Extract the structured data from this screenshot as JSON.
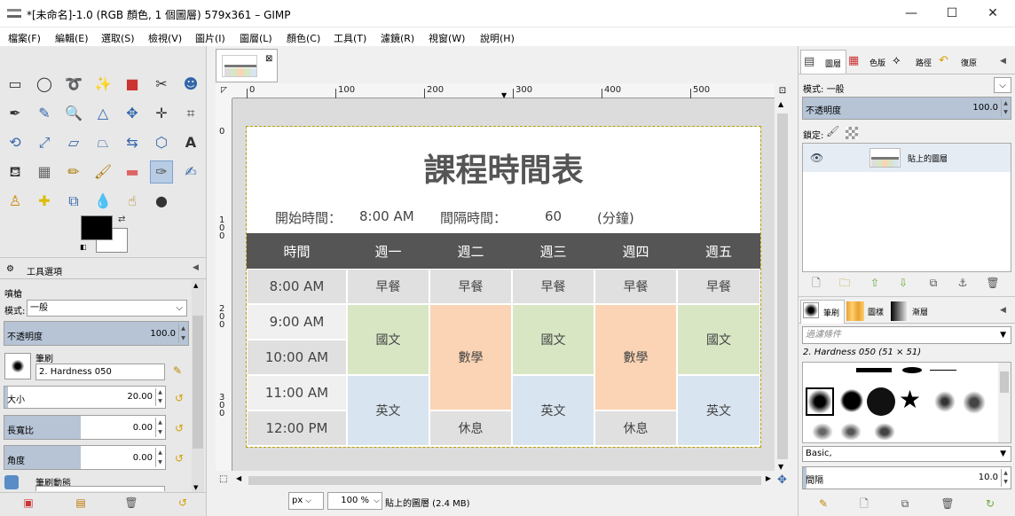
{
  "window": {
    "title": "*[未命名]-1.0 (RGB 顏色, 1 個圖層) 579x361 – GIMP",
    "minimize": "—",
    "maximize": "☐",
    "close": "✕"
  },
  "menu": [
    "檔案(F)",
    "編輯(E)",
    "選取(S)",
    "檢視(V)",
    "圖片(I)",
    "圖層(L)",
    "顏色(C)",
    "工具(T)",
    "濾鏡(R)",
    "視窗(W)",
    "說明(H)"
  ],
  "tool_options": {
    "tab_label": "工具選項",
    "tool_name": "噴槍",
    "mode_label": "模式:",
    "mode_value": "一般",
    "opacity_label": "不透明度",
    "opacity_value": "100.0",
    "opacity_fraction": 1.0,
    "brush_label": "筆刷",
    "brush_value": "2. Hardness 050",
    "size_label": "大小",
    "size_value": "20.00",
    "aspect_label": "長寬比",
    "aspect_value": "0.00",
    "angle_label": "角度",
    "angle_value": "0.00",
    "dynamics_label": "筆刷動態"
  },
  "image_window": {
    "ruler_h": [
      "0",
      "100",
      "200",
      "300",
      "400",
      "500"
    ],
    "ruler_v": [
      "0",
      "1\n0\n0",
      "2\n0\n0",
      "3\n0\n0"
    ],
    "unit": "px",
    "zoom": "100 %",
    "status": "貼上的圖層 (2.4 MB)"
  },
  "timetable": {
    "title": "課程時間表",
    "start_label": "開始時間：",
    "start_value": "8:00 AM",
    "interval_label": "間隔時間：",
    "interval_value": "60",
    "interval_unit": "(分鐘)",
    "headers": [
      "時間",
      "週一",
      "週二",
      "週三",
      "週四",
      "週五"
    ],
    "times": [
      "8:00 AM",
      "9:00 AM",
      "10:00 AM",
      "11:00 AM",
      "12:00 PM"
    ],
    "breakfast": "早餐",
    "chinese": "國文",
    "math": "數學",
    "english": "英文",
    "rest": "休息"
  },
  "layers": {
    "tabs": [
      "圖層",
      "色版",
      "路徑",
      "復原"
    ],
    "mode_label": "模式:",
    "mode_value": "一般",
    "opacity_label": "不透明度",
    "opacity_value": "100.0",
    "lock_label": "鎖定:",
    "layer_name": "貼上的圖層"
  },
  "brushes": {
    "tabs": [
      "筆刷",
      "圖樣",
      "漸層"
    ],
    "filter_placeholder": "過濾條件",
    "selected": "2. Hardness 050 (51 × 51)",
    "preset": "Basic,",
    "spacing_label": "間隔",
    "spacing_value": "10.0"
  }
}
